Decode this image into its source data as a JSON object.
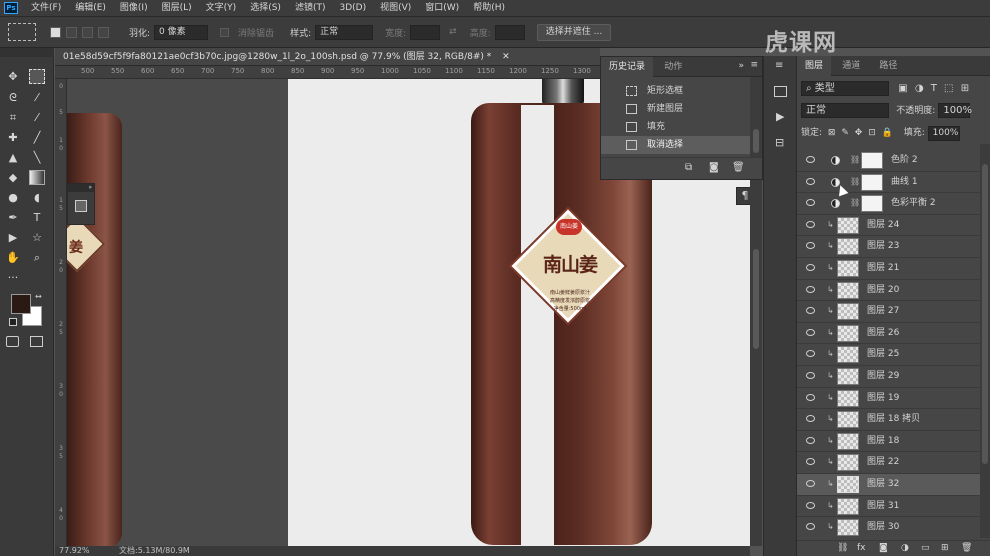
{
  "menubar": {
    "app_logo": "Ps",
    "items": [
      "文件(F)",
      "编辑(E)",
      "图像(I)",
      "图层(L)",
      "文字(Y)",
      "选择(S)",
      "滤镜(T)",
      "3D(D)",
      "视图(V)",
      "窗口(W)",
      "帮助(H)"
    ]
  },
  "options": {
    "feather_label": "羽化:",
    "feather_value": "0 像素",
    "antialias_label": "消除锯齿",
    "style_label": "样式:",
    "style_value": "正常",
    "width_label": "宽度:",
    "height_label": "高度:",
    "select_mask_button": "选择并遮住 ..."
  },
  "document": {
    "tab_title": "01e58d59cf5f9fa80121ae0cf3b70c.jpg@1280w_1l_2o_100sh.psd @ 77.9% (图层 32, RGB/8#) *",
    "zoom": "77.92%",
    "doc_size": "文档:5.13M/80.9M",
    "ruler_top": [
      "500",
      "550",
      "600",
      "650",
      "700",
      "750",
      "800",
      "850",
      "900",
      "950",
      "1000",
      "1050",
      "1100",
      "1150",
      "1200",
      "1250",
      "1300",
      "1350"
    ],
    "ruler_left": [
      "0",
      "5",
      "1",
      "0",
      "1",
      "5",
      "2",
      "0",
      "2",
      "5",
      "3",
      "0",
      "3",
      "5",
      "4",
      "0"
    ]
  },
  "product": {
    "brand_badge": "南山姜",
    "label_title": "南山姜",
    "label_line1": "南山姜鲜姜原浆汁",
    "label_line2": "高精度发浓醇原浆",
    "label_volume": "净含量:500ml"
  },
  "history_panel": {
    "tabs": [
      "历史记录",
      "动作"
    ],
    "items": [
      {
        "label": "矩形选框",
        "icon": "marquee-icon"
      },
      {
        "label": "新建图层",
        "icon": "layer-icon"
      },
      {
        "label": "填充",
        "icon": "layer-icon"
      },
      {
        "label": "取消选择",
        "icon": "layer-icon",
        "active": true
      }
    ]
  },
  "layers_panel": {
    "tabs": [
      "图层",
      "通道",
      "路径"
    ],
    "filter_value": "类型",
    "blend_mode": "正常",
    "opacity_label": "不透明度:",
    "opacity_value": "100%",
    "lock_label": "锁定:",
    "fill_label": "填充:",
    "fill_value": "100%",
    "layers": [
      {
        "name": "色阶 2",
        "type": "adjustment"
      },
      {
        "name": "曲线 1",
        "type": "adjustment"
      },
      {
        "name": "色彩平衡 2",
        "type": "adjustment"
      },
      {
        "name": "图层 24",
        "type": "pixel"
      },
      {
        "name": "图层 23",
        "type": "pixel"
      },
      {
        "name": "图层 21",
        "type": "pixel"
      },
      {
        "name": "图层 20",
        "type": "pixel"
      },
      {
        "name": "图层 27",
        "type": "pixel"
      },
      {
        "name": "图层 26",
        "type": "pixel"
      },
      {
        "name": "图层 25",
        "type": "pixel"
      },
      {
        "name": "图层 29",
        "type": "pixel"
      },
      {
        "name": "图层 19",
        "type": "pixel"
      },
      {
        "name": "图层 18 拷贝",
        "type": "pixel"
      },
      {
        "name": "图层 18",
        "type": "pixel"
      },
      {
        "name": "图层 22",
        "type": "pixel"
      },
      {
        "name": "图层 32",
        "type": "pixel",
        "selected": true
      },
      {
        "name": "图层 31",
        "type": "pixel"
      },
      {
        "name": "图层 30",
        "type": "pixel"
      }
    ]
  },
  "watermark": "虎课网",
  "colors": {
    "foreground": "#2b1a14",
    "background": "#ffffff",
    "bottle": "#5a2b22",
    "panel": "#464646",
    "selected_row": "#5a5a5a",
    "accent": "#31a8ff"
  }
}
